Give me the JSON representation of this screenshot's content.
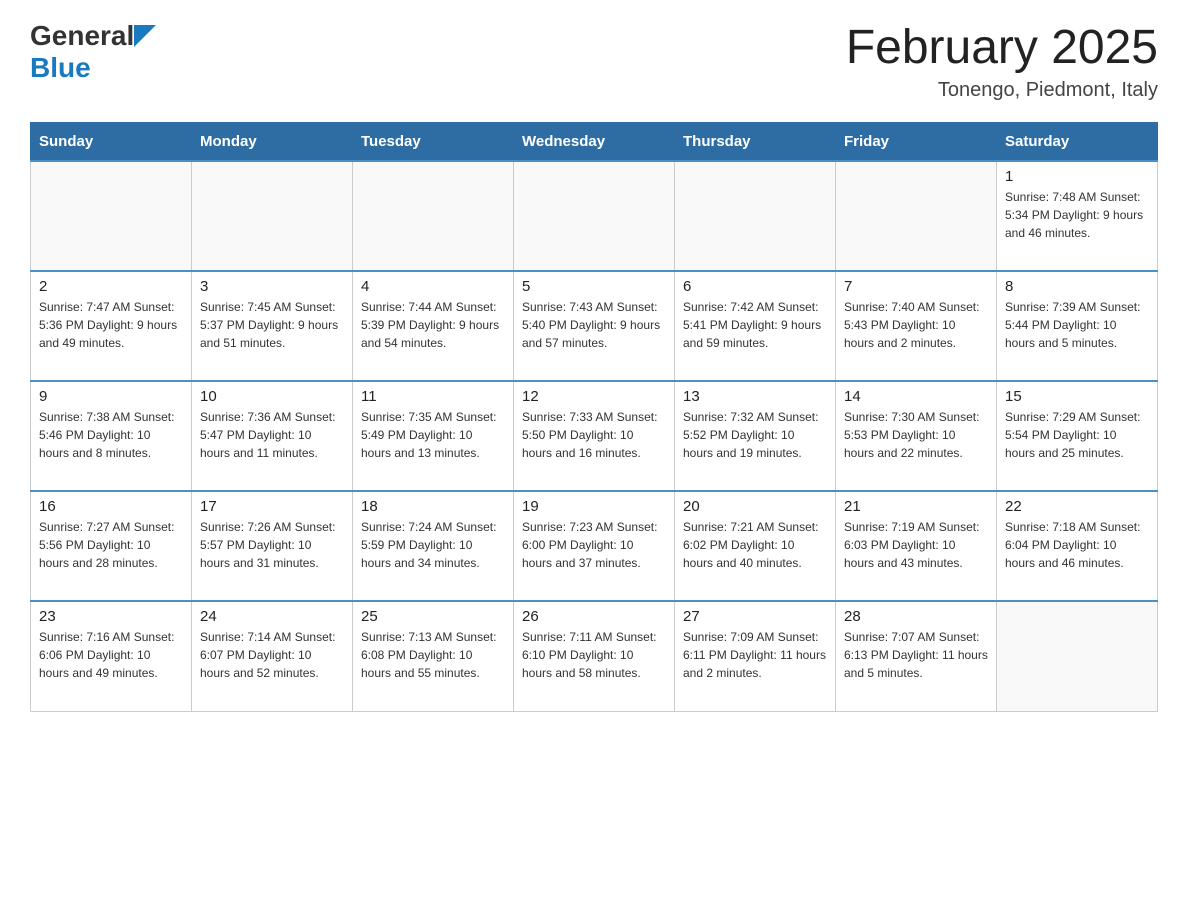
{
  "header": {
    "title": "February 2025",
    "location": "Tonengo, Piedmont, Italy",
    "logo_general": "General",
    "logo_blue": "Blue"
  },
  "days_of_week": [
    "Sunday",
    "Monday",
    "Tuesday",
    "Wednesday",
    "Thursday",
    "Friday",
    "Saturday"
  ],
  "weeks": [
    [
      {
        "day": "",
        "info": ""
      },
      {
        "day": "",
        "info": ""
      },
      {
        "day": "",
        "info": ""
      },
      {
        "day": "",
        "info": ""
      },
      {
        "day": "",
        "info": ""
      },
      {
        "day": "",
        "info": ""
      },
      {
        "day": "1",
        "info": "Sunrise: 7:48 AM\nSunset: 5:34 PM\nDaylight: 9 hours and 46 minutes."
      }
    ],
    [
      {
        "day": "2",
        "info": "Sunrise: 7:47 AM\nSunset: 5:36 PM\nDaylight: 9 hours and 49 minutes."
      },
      {
        "day": "3",
        "info": "Sunrise: 7:45 AM\nSunset: 5:37 PM\nDaylight: 9 hours and 51 minutes."
      },
      {
        "day": "4",
        "info": "Sunrise: 7:44 AM\nSunset: 5:39 PM\nDaylight: 9 hours and 54 minutes."
      },
      {
        "day": "5",
        "info": "Sunrise: 7:43 AM\nSunset: 5:40 PM\nDaylight: 9 hours and 57 minutes."
      },
      {
        "day": "6",
        "info": "Sunrise: 7:42 AM\nSunset: 5:41 PM\nDaylight: 9 hours and 59 minutes."
      },
      {
        "day": "7",
        "info": "Sunrise: 7:40 AM\nSunset: 5:43 PM\nDaylight: 10 hours and 2 minutes."
      },
      {
        "day": "8",
        "info": "Sunrise: 7:39 AM\nSunset: 5:44 PM\nDaylight: 10 hours and 5 minutes."
      }
    ],
    [
      {
        "day": "9",
        "info": "Sunrise: 7:38 AM\nSunset: 5:46 PM\nDaylight: 10 hours and 8 minutes."
      },
      {
        "day": "10",
        "info": "Sunrise: 7:36 AM\nSunset: 5:47 PM\nDaylight: 10 hours and 11 minutes."
      },
      {
        "day": "11",
        "info": "Sunrise: 7:35 AM\nSunset: 5:49 PM\nDaylight: 10 hours and 13 minutes."
      },
      {
        "day": "12",
        "info": "Sunrise: 7:33 AM\nSunset: 5:50 PM\nDaylight: 10 hours and 16 minutes."
      },
      {
        "day": "13",
        "info": "Sunrise: 7:32 AM\nSunset: 5:52 PM\nDaylight: 10 hours and 19 minutes."
      },
      {
        "day": "14",
        "info": "Sunrise: 7:30 AM\nSunset: 5:53 PM\nDaylight: 10 hours and 22 minutes."
      },
      {
        "day": "15",
        "info": "Sunrise: 7:29 AM\nSunset: 5:54 PM\nDaylight: 10 hours and 25 minutes."
      }
    ],
    [
      {
        "day": "16",
        "info": "Sunrise: 7:27 AM\nSunset: 5:56 PM\nDaylight: 10 hours and 28 minutes."
      },
      {
        "day": "17",
        "info": "Sunrise: 7:26 AM\nSunset: 5:57 PM\nDaylight: 10 hours and 31 minutes."
      },
      {
        "day": "18",
        "info": "Sunrise: 7:24 AM\nSunset: 5:59 PM\nDaylight: 10 hours and 34 minutes."
      },
      {
        "day": "19",
        "info": "Sunrise: 7:23 AM\nSunset: 6:00 PM\nDaylight: 10 hours and 37 minutes."
      },
      {
        "day": "20",
        "info": "Sunrise: 7:21 AM\nSunset: 6:02 PM\nDaylight: 10 hours and 40 minutes."
      },
      {
        "day": "21",
        "info": "Sunrise: 7:19 AM\nSunset: 6:03 PM\nDaylight: 10 hours and 43 minutes."
      },
      {
        "day": "22",
        "info": "Sunrise: 7:18 AM\nSunset: 6:04 PM\nDaylight: 10 hours and 46 minutes."
      }
    ],
    [
      {
        "day": "23",
        "info": "Sunrise: 7:16 AM\nSunset: 6:06 PM\nDaylight: 10 hours and 49 minutes."
      },
      {
        "day": "24",
        "info": "Sunrise: 7:14 AM\nSunset: 6:07 PM\nDaylight: 10 hours and 52 minutes."
      },
      {
        "day": "25",
        "info": "Sunrise: 7:13 AM\nSunset: 6:08 PM\nDaylight: 10 hours and 55 minutes."
      },
      {
        "day": "26",
        "info": "Sunrise: 7:11 AM\nSunset: 6:10 PM\nDaylight: 10 hours and 58 minutes."
      },
      {
        "day": "27",
        "info": "Sunrise: 7:09 AM\nSunset: 6:11 PM\nDaylight: 11 hours and 2 minutes."
      },
      {
        "day": "28",
        "info": "Sunrise: 7:07 AM\nSunset: 6:13 PM\nDaylight: 11 hours and 5 minutes."
      },
      {
        "day": "",
        "info": ""
      }
    ]
  ]
}
